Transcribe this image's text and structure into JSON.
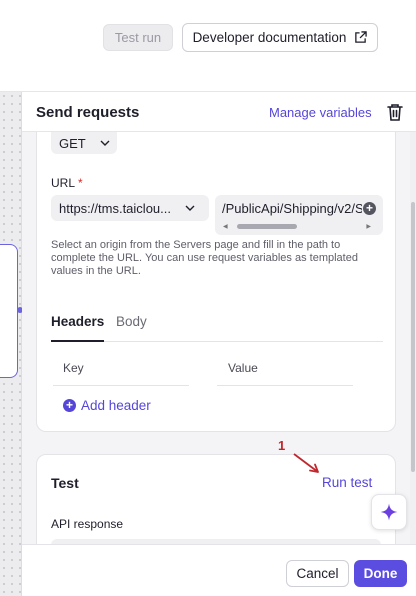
{
  "toolbar": {
    "test_run_label": "Test run",
    "dev_docs_label": "Developer documentation",
    "dev_docs_icon": "external-link-icon"
  },
  "panel": {
    "title": "Send requests",
    "manage_variables_label": "Manage variables",
    "delete_icon": "trash-icon"
  },
  "request": {
    "method": "GET",
    "url_label": "URL",
    "required_marker": "*",
    "origin_value": "https://tms.taiclou...",
    "path_value": "/PublicApi/Shipping/v2/S",
    "helper_text": "Select an origin from the Servers page and fill in the path to complete the URL. You can use request variables as templated values in the URL.",
    "tabs": [
      {
        "label": "Headers",
        "active": true
      },
      {
        "label": "Body",
        "active": false
      }
    ],
    "headers_table": {
      "columns": [
        "Key",
        "Value"
      ]
    },
    "add_header_label": "Add header"
  },
  "test": {
    "title": "Test",
    "run_test_label": "Run test",
    "api_response_label": "API response"
  },
  "annotation": {
    "number": "1",
    "color": "#c0262d"
  },
  "footer": {
    "cancel_label": "Cancel",
    "done_label": "Done"
  },
  "colors": {
    "accent": "#5b4de0",
    "link": "#5546d8"
  }
}
